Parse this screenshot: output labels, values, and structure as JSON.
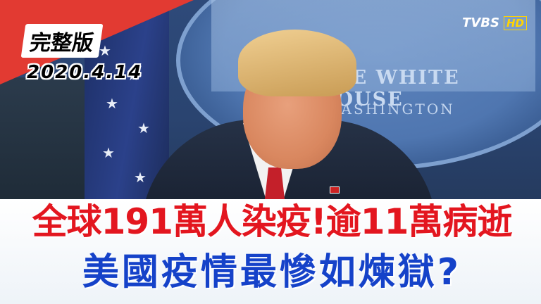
{
  "badge": {
    "title": "完整版",
    "date": "2020.4.14"
  },
  "broadcaster": {
    "logo_text": "TVBS",
    "hd_text": "HD"
  },
  "backdrop": {
    "seal_line1": "THE WHITE HOUSE",
    "seal_line2": "WASHINGTON"
  },
  "headline": {
    "line1": "全球191萬人染疫!逾11萬病逝",
    "line2": "美國疫情最慘如煉獄?"
  },
  "colors": {
    "accent_red": "#e23a32",
    "headline_red": "#e3161f",
    "headline_blue": "#1542c9"
  }
}
